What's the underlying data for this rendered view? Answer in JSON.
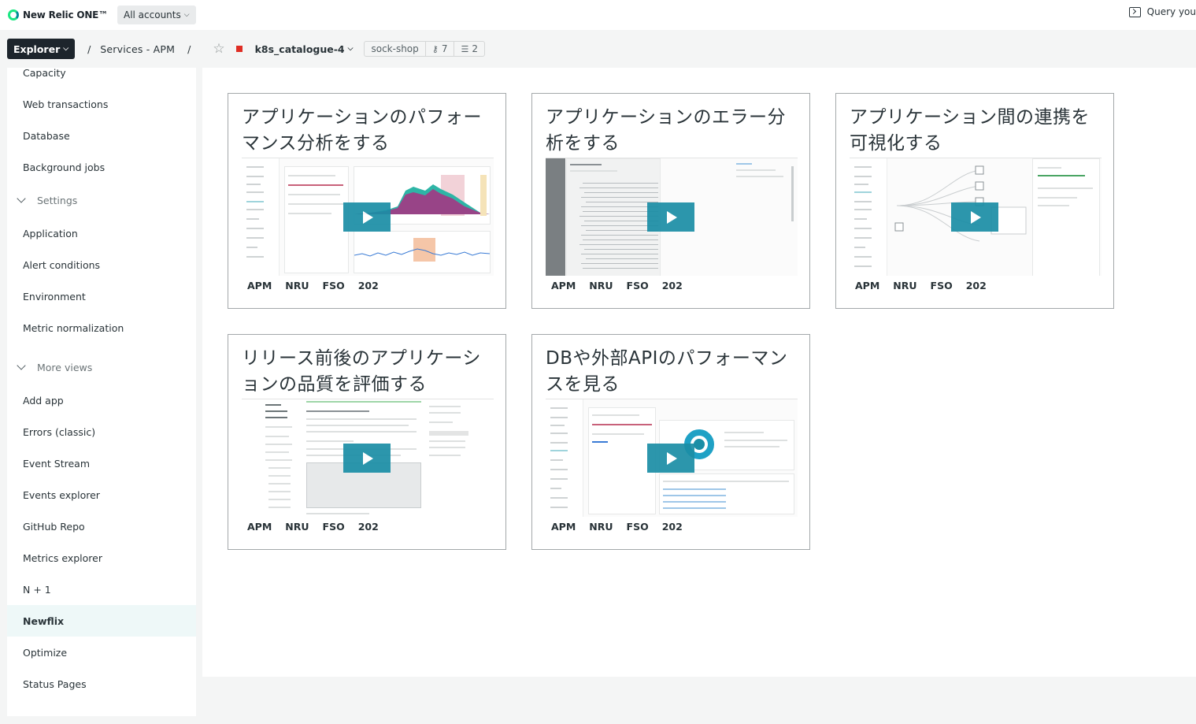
{
  "topbar": {
    "logo_text": "New Relic ONE™",
    "accounts_label": "All accounts",
    "query_label": "Query you"
  },
  "breadcrumb": {
    "explorer_label": "Explorer",
    "separator": "/",
    "services_label": "Services - APM",
    "entity_name": "k8s_catalogue-4",
    "entity_status_color": "#df2d24",
    "tag_label": "sock-shop",
    "tag_count": "7",
    "related_count": "2"
  },
  "sidebar": {
    "items_top": [
      "Capacity",
      "Web transactions",
      "Database",
      "Background jobs"
    ],
    "settings_label": "Settings",
    "settings_items": [
      "Application",
      "Alert conditions",
      "Environment",
      "Metric normalization"
    ],
    "more_views_label": "More views",
    "more_views_items": [
      "Add app",
      "Errors (classic)",
      "Event Stream",
      "Events explorer",
      "GitHub Repo",
      "Metrics explorer",
      "N + 1",
      "Newflix",
      "Optimize",
      "Status Pages"
    ],
    "active_item": "Newflix"
  },
  "cards": [
    {
      "title": "アプリケーションのパフォーマンス分析をする",
      "tags": [
        "APM",
        "NRU",
        "FSO",
        "202"
      ]
    },
    {
      "title": "アプリケーションのエラー分析をする",
      "tags": [
        "APM",
        "NRU",
        "FSO",
        "202"
      ]
    },
    {
      "title": "アプリケーション間の連携を可視化する",
      "tags": [
        "APM",
        "NRU",
        "FSO",
        "202"
      ]
    },
    {
      "title": "リリース前後のアプリケーションの品質を評価する",
      "tags": [
        "APM",
        "NRU",
        "FSO",
        "202"
      ]
    },
    {
      "title": "DBや外部APIのパフォーマンスを見る",
      "tags": [
        "APM",
        "NRU",
        "FSO",
        "202"
      ]
    }
  ],
  "colors": {
    "accent": "#1b8ea6",
    "active_bg": "#eef8f8",
    "explorer_bg": "#1d252c"
  },
  "icons": {
    "logo": "new-relic-logo-icon",
    "query": "terminal-icon",
    "star": "star-icon",
    "tag": "tag-icon",
    "related": "stack-icon",
    "play": "play-icon"
  }
}
